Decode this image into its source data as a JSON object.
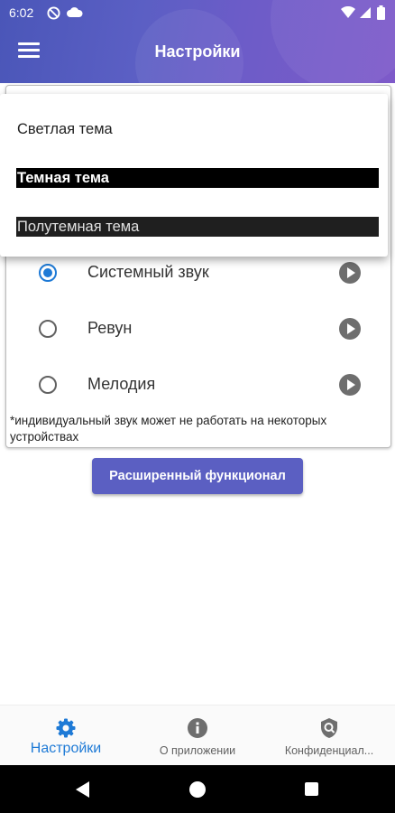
{
  "status_bar": {
    "time": "6:02"
  },
  "app_bar": {
    "title": "Настройки",
    "menu_icon": "hamburger-menu-icon"
  },
  "theme_menu": {
    "items": [
      {
        "label": "Светлая тема"
      },
      {
        "label": "Темная тема"
      },
      {
        "label": "Полутемная тема"
      }
    ]
  },
  "sound": {
    "options": [
      {
        "label": "Системный звук",
        "selected": true
      },
      {
        "label": "Ревун",
        "selected": false
      },
      {
        "label": "Мелодия",
        "selected": false
      }
    ],
    "note": "*индивидуальный звук может не работать на некоторых устройствах"
  },
  "extended_button": {
    "label": "Расширенный функционал"
  },
  "bottom_nav": {
    "items": [
      {
        "label": "Настройки",
        "icon": "gear-icon",
        "active": true
      },
      {
        "label": "О приложении",
        "icon": "info-icon",
        "active": false
      },
      {
        "label": "Конфиденциал...",
        "icon": "privacy-shield-icon",
        "active": false
      }
    ]
  },
  "colors": {
    "accent": "#1e7ad6",
    "primary": "#5b5fc2"
  }
}
